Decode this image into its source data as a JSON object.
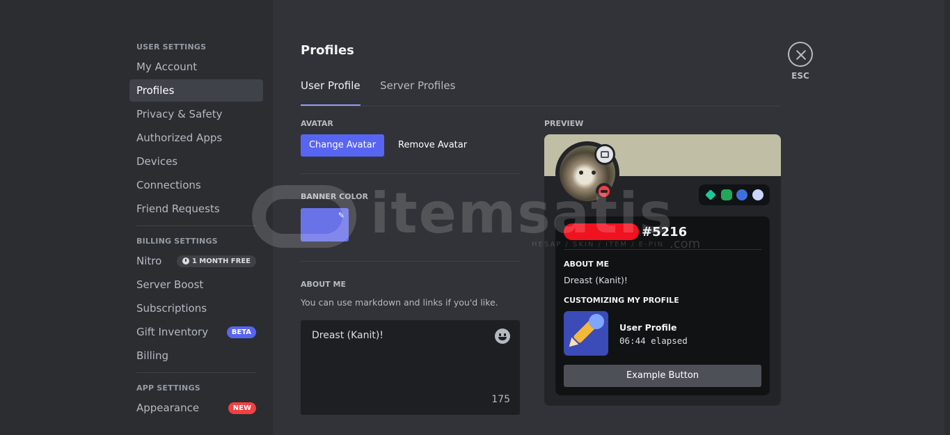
{
  "sidebar": {
    "sections": [
      {
        "header": "User Settings",
        "items": [
          "My Account",
          "Profiles",
          "Privacy & Safety",
          "Authorized Apps",
          "Devices",
          "Connections",
          "Friend Requests"
        ]
      },
      {
        "header": "Billing Settings",
        "items": [
          "Nitro",
          "Server Boost",
          "Subscriptions",
          "Gift Inventory",
          "Billing"
        ]
      },
      {
        "header": "App Settings",
        "items": [
          "Appearance"
        ]
      }
    ],
    "active_item": "Profiles",
    "nitro_badge": "1 MONTH FREE",
    "gift_badge": "BETA",
    "appearance_badge": "NEW"
  },
  "main": {
    "title": "Profiles",
    "tabs": [
      {
        "label": "User Profile",
        "active": true
      },
      {
        "label": "Server Profiles",
        "active": false
      }
    ],
    "avatar_label": "Avatar",
    "change_avatar": "Change Avatar",
    "remove_avatar": "Remove Avatar",
    "banner_color_label": "Banner Color",
    "banner_color": "#6a72e8",
    "about_me_label": "About Me",
    "about_me_hint": "You can use markdown and links if you'd like.",
    "about_me_value": "Dreast (Kanit)!",
    "char_count": "175"
  },
  "preview": {
    "label": "Preview",
    "banner_color": "#c0bfa6",
    "discriminator": "#5216",
    "about_me_label": "About Me",
    "about_me_text": "Dreast (Kanit)!",
    "activity_label": "Customizing My Profile",
    "activity_title": "User Profile",
    "activity_time": "06:44 elapsed",
    "example_button": "Example Button"
  },
  "close": {
    "label": "ESC"
  },
  "watermark": {
    "text": "itemsatis",
    "sub": "HESAP / SKIN / ITEM / E-PIN",
    "suffix": ".com"
  }
}
